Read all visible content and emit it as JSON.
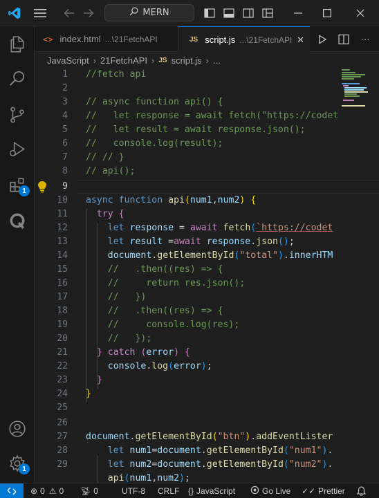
{
  "titlebar": {
    "search_text": "MERN",
    "search_icon": "search-icon"
  },
  "tabs": [
    {
      "name": "index.html",
      "desc": "...\\21FetchAPI",
      "icon": "html-icon"
    },
    {
      "name": "script.js",
      "desc": "...\\21FetchAPI",
      "icon_text": "JS",
      "close": "✕"
    }
  ],
  "breadcrumb": {
    "items": [
      "JavaScript",
      "21FetchAPI",
      "script.js",
      "..."
    ],
    "js_icon": "JS"
  },
  "activity": {
    "extensions_badge": "1",
    "settings_badge": "1"
  },
  "editor": {
    "line_numbers": [
      "1",
      "2",
      "3",
      "4",
      "5",
      "6",
      "7",
      "8",
      "9",
      "10",
      "11",
      "12",
      "13",
      "14",
      "15",
      "16",
      "17",
      "18",
      "19",
      "20",
      "21",
      "22",
      "23",
      "24",
      "25",
      "26",
      "27",
      "28",
      "29"
    ],
    "active_line": "9"
  },
  "statusbar": {
    "errors": "0",
    "warnings": "0",
    "ports": "0",
    "encoding": "UTF-8",
    "eol": "CRLF",
    "language": "JavaScript",
    "golive": "Go Live",
    "prettier": "Prettier",
    "braces": "{}"
  },
  "colors": {
    "accent": "#0078d4",
    "background": "#1f1f1f",
    "comment": "#6a9955",
    "keyword": "#569cd6",
    "string": "#ce9178"
  }
}
